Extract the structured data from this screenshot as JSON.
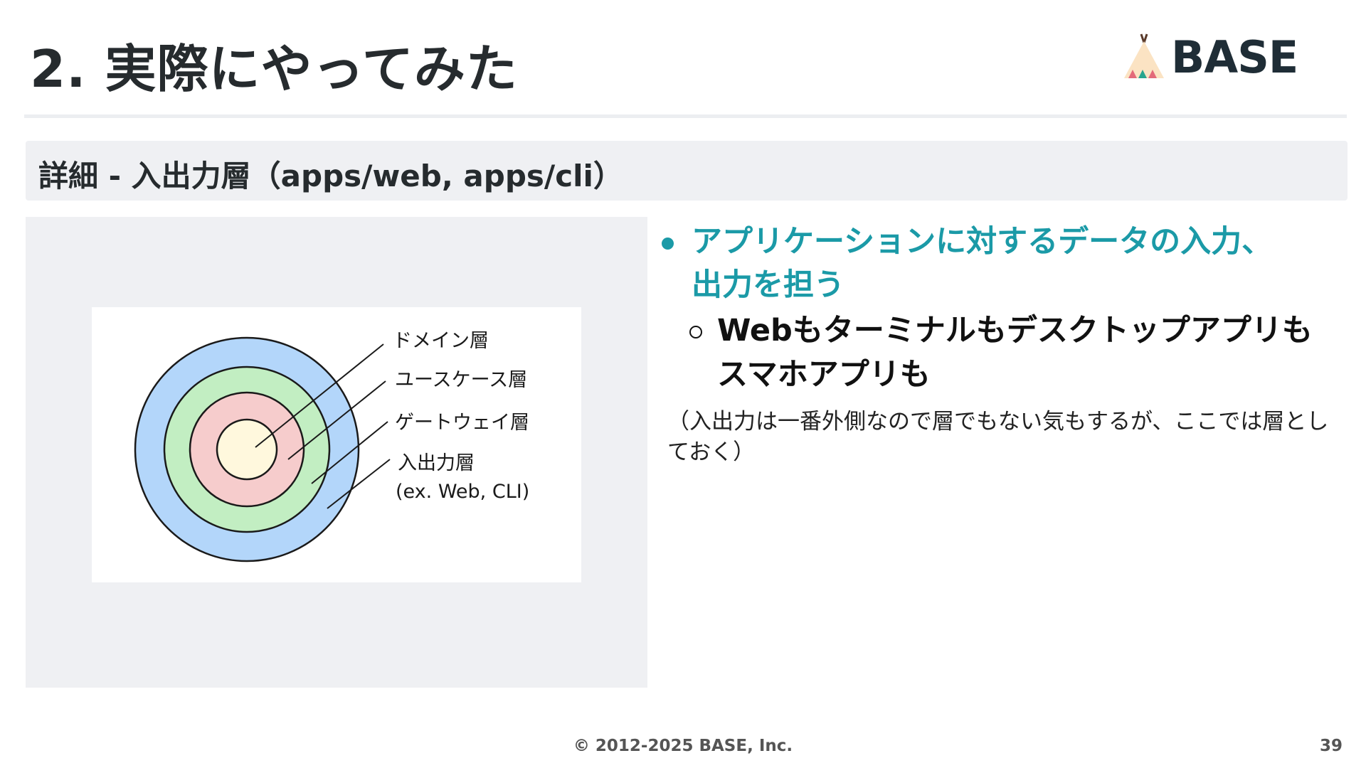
{
  "slide": {
    "title": "2. 実際にやってみた",
    "logo_text": "BASE",
    "section_heading": "詳細 - 入出力層（apps/web, apps/cli）"
  },
  "diagram": {
    "labels": {
      "domain": "ドメイン層",
      "usecase": "ユースケース層",
      "gateway": "ゲートウェイ層",
      "io": "入出力層",
      "io_sub": "(ex. Web, CLI)"
    },
    "colors": {
      "outer": "#b3d6fa",
      "ring2": "#c2eec2",
      "ring3": "#f6cccc",
      "center": "#fff8dd",
      "stroke": "#1a1a1a"
    }
  },
  "content": {
    "bullet_main": "アプリケーションに対するデータの入力、出力を担う",
    "bullet_sub": "Webもターミナルもデスクトップアプリもスマホアプリも",
    "note": "（入出力は一番外側なので層でもない気もするが、ここでは層としておく）"
  },
  "footer": {
    "copyright": "© 2012-2025 BASE, Inc.",
    "page_number": "39"
  },
  "colors": {
    "accent": "#1b9aa7",
    "title": "#262b2e",
    "section_bg": "#eff0f3"
  }
}
